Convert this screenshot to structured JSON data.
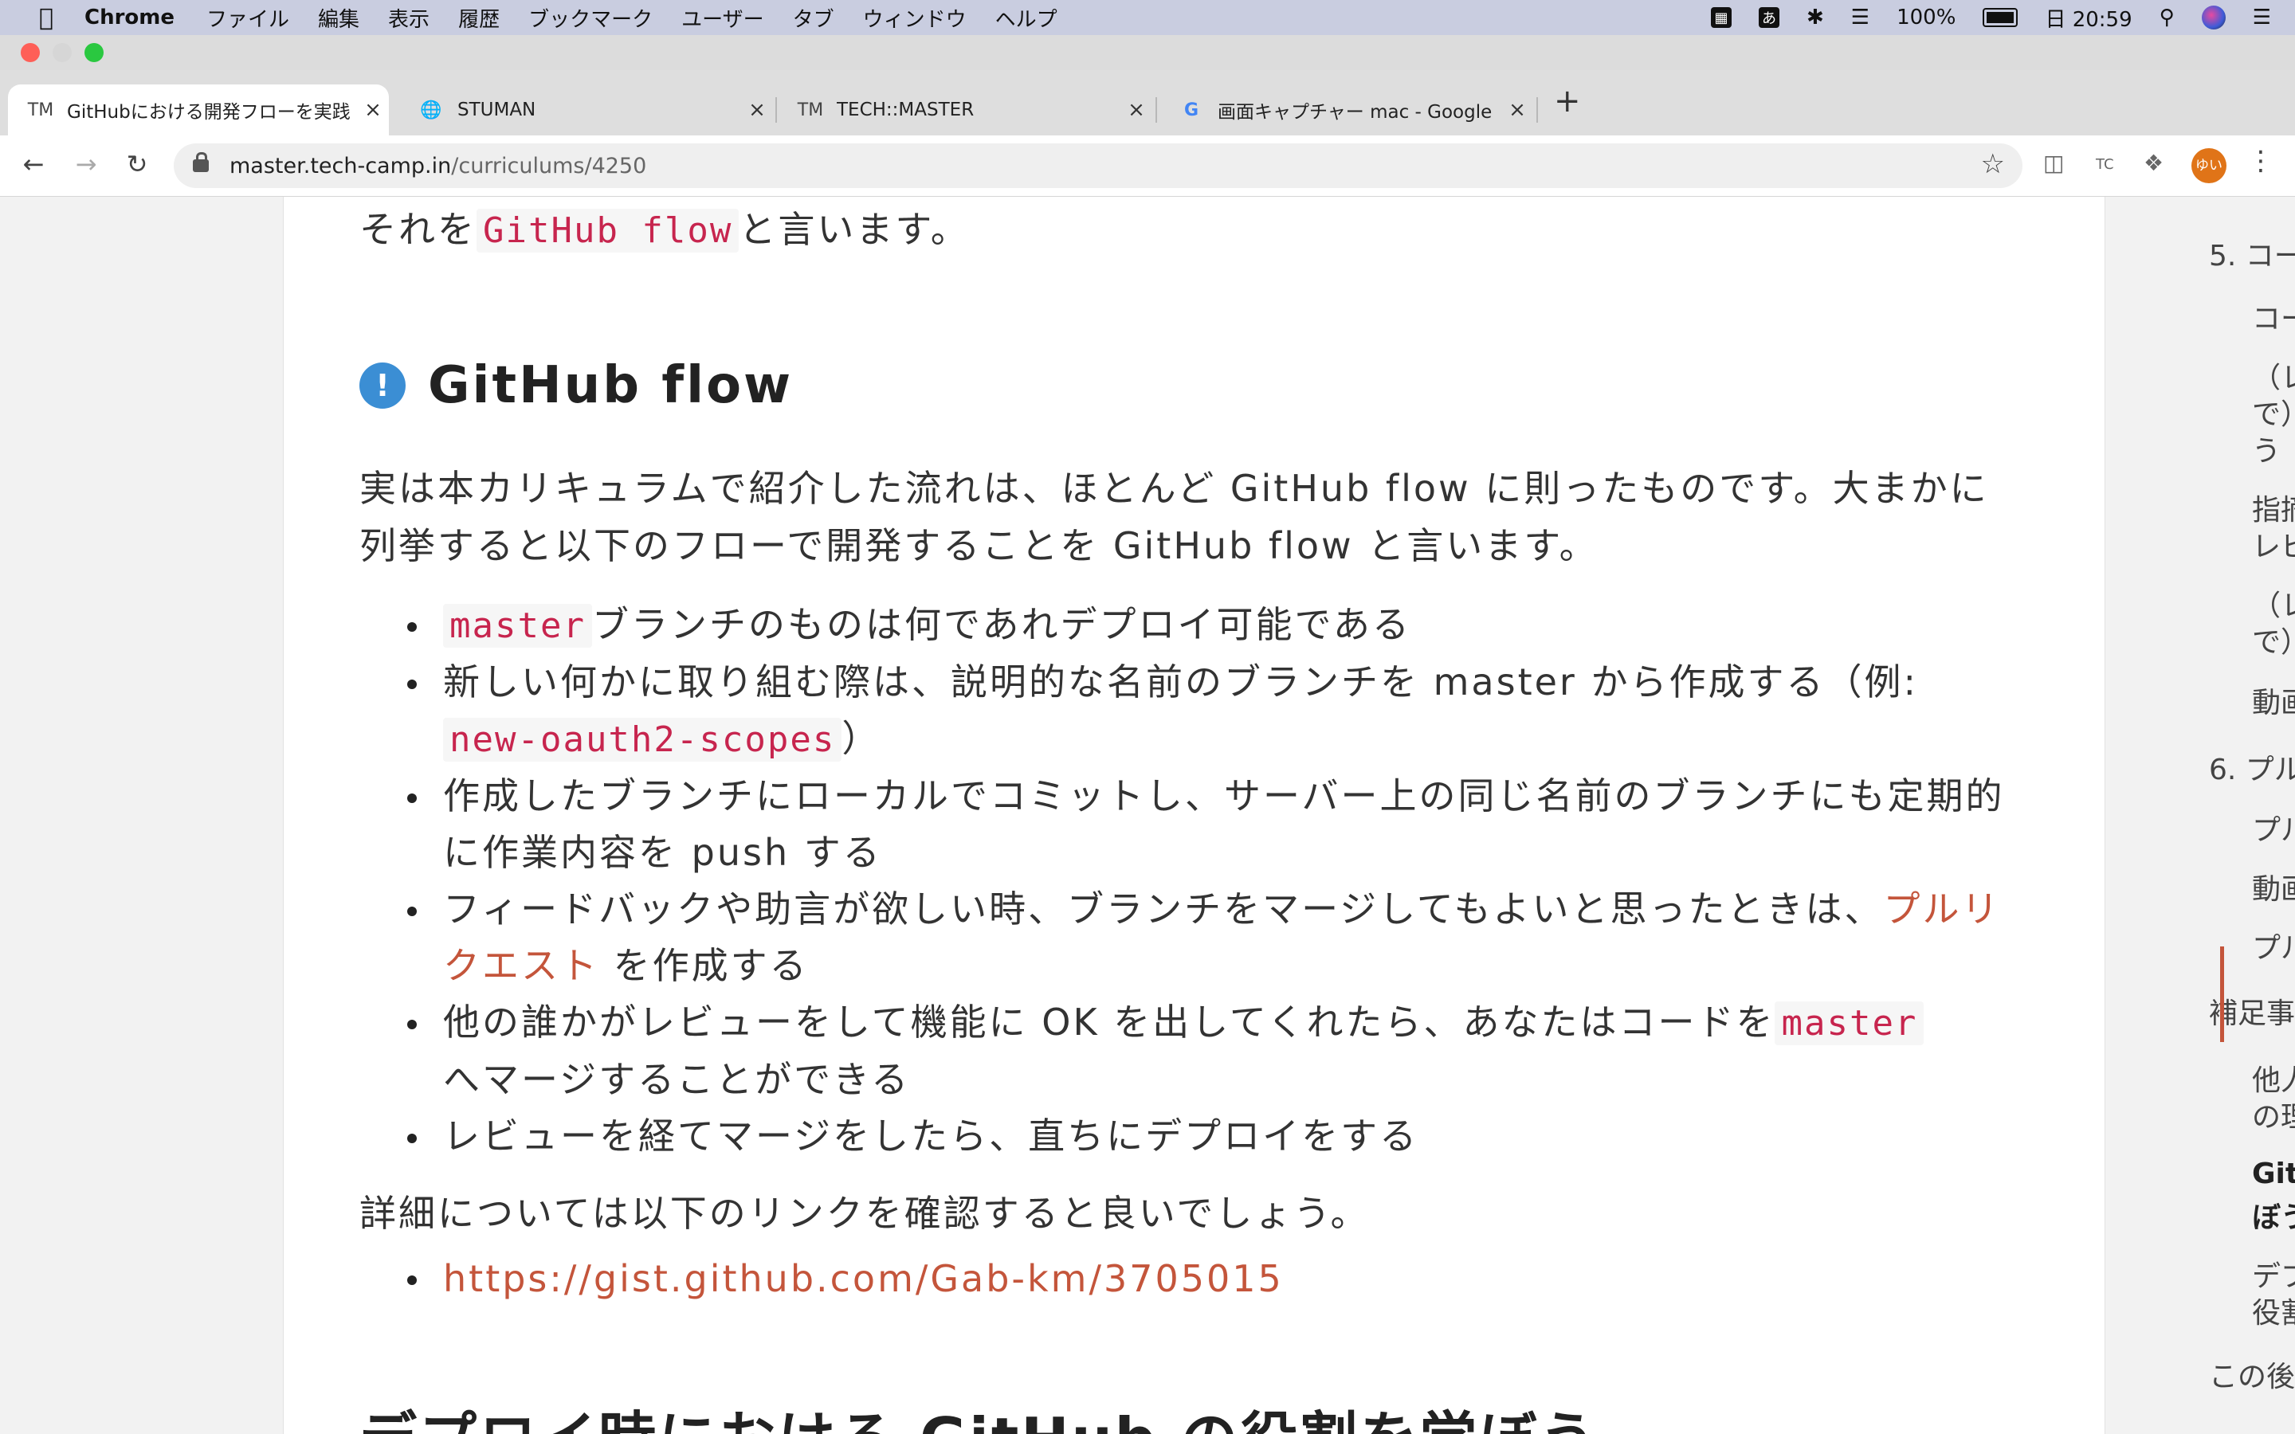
{
  "menubar": {
    "app_name": "Chrome",
    "menus": [
      "ファイル",
      "編集",
      "表示",
      "履歴",
      "ブックマーク",
      "ユーザー",
      "タブ",
      "ウィンドウ",
      "ヘルプ"
    ],
    "input_source": "あ",
    "battery": "100%",
    "clock": "日 20:59"
  },
  "tabs": [
    {
      "favicon": "TM",
      "title": "GitHubにおける開発フローを実践",
      "active": true
    },
    {
      "favicon": "globe-icon",
      "title": "STUMAN",
      "active": false
    },
    {
      "favicon": "TM",
      "title": "TECH::MASTER",
      "active": false
    },
    {
      "favicon": "G",
      "title": "画面キャプチャー mac - Google",
      "active": false
    }
  ],
  "toolbar": {
    "url_host": "master.tech-camp.in",
    "url_path": "/curriculums/4250",
    "profile_label": "ゆい",
    "ext_tc": "TC"
  },
  "article": {
    "intro_prefix": "それを",
    "intro_code": "GitHub flow",
    "intro_suffix": "と言います。",
    "heading": "GitHub flow",
    "heading_icon": "!",
    "paragraph": "実は本カリキュラムで紹介した流れは、ほとんど GitHub flow に則ったものです。大まかに列挙すると以下のフローで開発することを GitHub flow と言います。",
    "bullets": {
      "b1_code": "master",
      "b1_text": "ブランチのものは何であれデプロイ可能である",
      "b2_text": "新しい何かに取り組む際は、説明的な名前のブランチを master から作成する（例:",
      "b2_code": "new-oauth2-scopes",
      "b2_close": "）",
      "b3_text": "作成したブランチにローカルでコミットし、サーバー上の同じ名前のブランチにも定期的に作業内容を push する",
      "b4_text": "フィードバックや助言が欲しい時、ブランチをマージしてもよいと思ったときは、",
      "b4_link": "プルリクエスト",
      "b4_suffix": " を作成する",
      "b5_text": "他の誰かがレビューをして機能に OK を出してくれたら、あなたはコードを",
      "b5_code": "master",
      "b5_suffix": "へマージすることができる",
      "b6_text": "レビューを経てマージをしたら、直ちにデプロイをする"
    },
    "detail": "詳細については以下のリンクを確認すると良いでしょう。",
    "gist_link": "https://gist.github.com/Gab-km/3705015",
    "next_heading": "デプロイ時における GitHub の役割を学ぼう"
  },
  "toc": {
    "items": [
      "5. コー",
      "コー",
      "（レ",
      "で）",
      "う",
      "指摘",
      "レビ",
      "（レ",
      "で）",
      "動画",
      "6. プル",
      "プル",
      "動画",
      "プル",
      "補足事",
      "他人",
      "の理",
      "Git",
      "ぼう",
      "デプ",
      "役割",
      "この後"
    ]
  }
}
